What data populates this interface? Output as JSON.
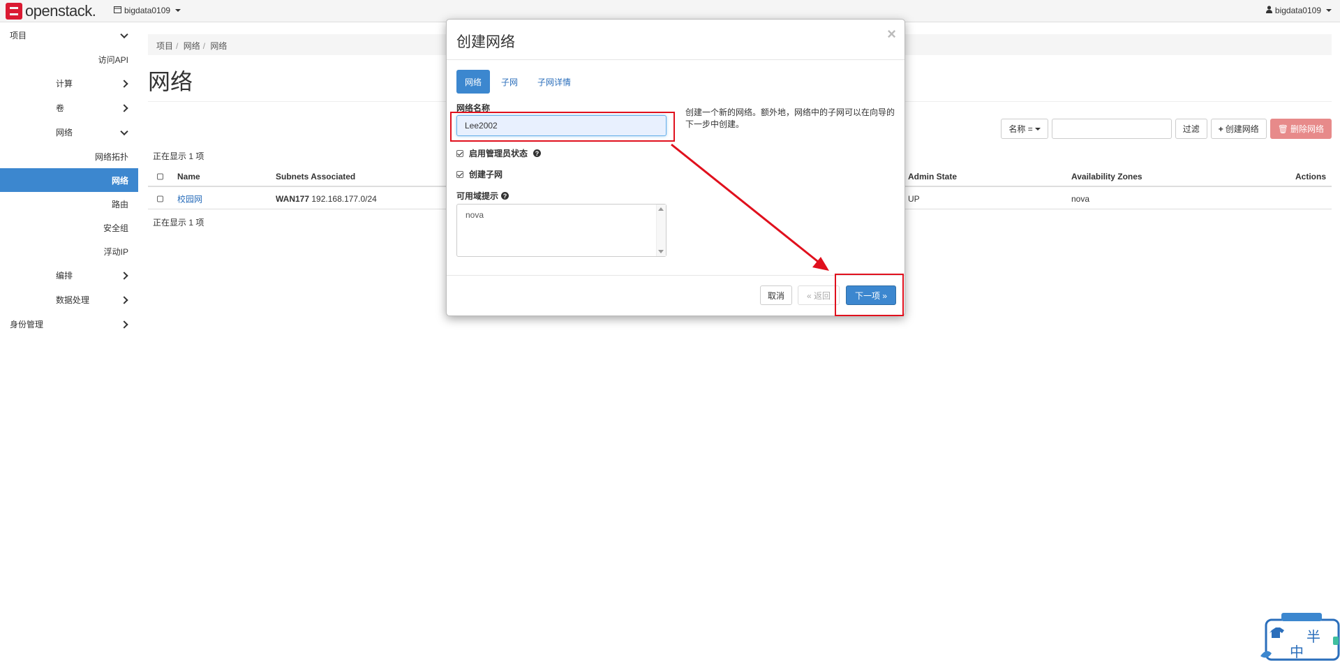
{
  "navbar": {
    "brand": "openstack.",
    "project": "bigdata0109",
    "user": "bigdata0109"
  },
  "sidebar": {
    "items": [
      {
        "label": "项目",
        "level": 0,
        "chevron": "down"
      },
      {
        "label": "访问API",
        "level": 2
      },
      {
        "label": "计算",
        "level": 1,
        "chevron": "right"
      },
      {
        "label": "卷",
        "level": 1,
        "chevron": "right"
      },
      {
        "label": "网络",
        "level": 1,
        "chevron": "down"
      },
      {
        "label": "网络拓扑",
        "level": 2
      },
      {
        "label": "网络",
        "level": 2,
        "active": true
      },
      {
        "label": "路由",
        "level": 2
      },
      {
        "label": "安全组",
        "level": 2
      },
      {
        "label": "浮动IP",
        "level": 2
      },
      {
        "label": "编排",
        "level": 1,
        "chevron": "right"
      },
      {
        "label": "数据处理",
        "level": 1,
        "chevron": "right"
      },
      {
        "label": "身份管理",
        "level": 0,
        "chevron": "right"
      }
    ]
  },
  "breadcrumb": [
    "项目",
    "网络",
    "网络"
  ],
  "page_title": "网络",
  "filter": {
    "field": "名称 =",
    "filter_btn": "过滤",
    "create_btn": "创建网络",
    "delete_btn": "删除网络"
  },
  "table": {
    "count_text": "正在显示 1 项",
    "columns": [
      "Name",
      "Subnets Associated",
      "Admin State",
      "Availability Zones",
      "Actions"
    ],
    "rows": [
      {
        "name": "校园网",
        "subnet_name": "WAN177",
        "subnet_cidr": "192.168.177.0/24",
        "admin_state": "UP",
        "zones": "nova"
      }
    ]
  },
  "modal": {
    "title": "创建网络",
    "close": "×",
    "tabs": [
      "网络",
      "子网",
      "子网详情"
    ],
    "name_label": "网络名称",
    "name_value": "Lee2002",
    "admin_state_label": "启用管理员状态",
    "create_subnet_label": "创建子网",
    "az_label": "可用域提示",
    "az_value": "nova",
    "help_text": "创建一个新的网络。额外地，网络中的子网可以在向导的下一步中创建。",
    "cancel": "取消",
    "back": "« 返回",
    "next": "下一项 »"
  },
  "colors": {
    "primary": "#3c87cf",
    "danger": "#e78a8a",
    "annotation": "#e0101d",
    "brand": "#da1a32"
  },
  "mascot": {
    "glyph_top": "半",
    "glyph_bottom": "中"
  }
}
